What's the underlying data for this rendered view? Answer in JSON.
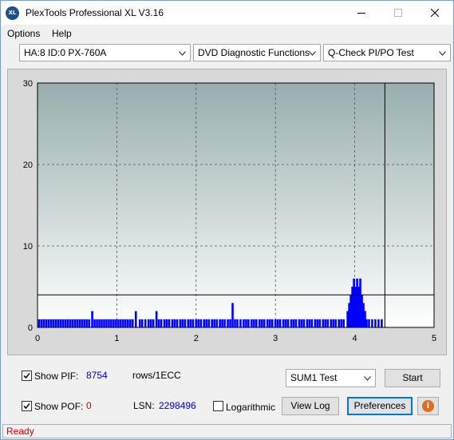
{
  "window": {
    "title": "PlexTools Professional XL V3.16",
    "icon_text": "XL"
  },
  "menu": {
    "options": "Options",
    "help": "Help"
  },
  "toolbar": {
    "drive": "HA:8 ID:0  PX-760A",
    "function": "DVD Diagnostic Functions",
    "test": "Q-Check PI/PO Test"
  },
  "chart_data": {
    "type": "bar",
    "title": "",
    "xlabel": "",
    "ylabel": "",
    "xlim": [
      0,
      5
    ],
    "ylim": [
      0,
      30
    ],
    "x_ticks": [
      "0",
      "1",
      "2",
      "3",
      "4",
      "5"
    ],
    "y_ticks": [
      "0",
      "10",
      "20",
      "30"
    ],
    "grid": true,
    "threshold_y": 4,
    "end_marker_x": 4.38,
    "colors": {
      "bars": "#0000ff",
      "cursor": "#000000"
    },
    "series": [
      {
        "values": [
          [
            0.02,
            1
          ],
          [
            0.05,
            1
          ],
          [
            0.08,
            1
          ],
          [
            0.11,
            1
          ],
          [
            0.14,
            1
          ],
          [
            0.17,
            1
          ],
          [
            0.2,
            1
          ],
          [
            0.23,
            1
          ],
          [
            0.26,
            1
          ],
          [
            0.29,
            1
          ],
          [
            0.32,
            1
          ],
          [
            0.35,
            1
          ],
          [
            0.38,
            1
          ],
          [
            0.41,
            1
          ],
          [
            0.44,
            1
          ],
          [
            0.47,
            1
          ],
          [
            0.5,
            1
          ],
          [
            0.53,
            1
          ],
          [
            0.56,
            1
          ],
          [
            0.59,
            1
          ],
          [
            0.62,
            1
          ],
          [
            0.65,
            1
          ],
          [
            0.69,
            2
          ],
          [
            0.72,
            1
          ],
          [
            0.75,
            1
          ],
          [
            0.78,
            1
          ],
          [
            0.81,
            1
          ],
          [
            0.84,
            1
          ],
          [
            0.87,
            1
          ],
          [
            0.9,
            1
          ],
          [
            0.93,
            1
          ],
          [
            0.96,
            1
          ],
          [
            0.99,
            1
          ],
          [
            1.02,
            1
          ],
          [
            1.05,
            1
          ],
          [
            1.08,
            1
          ],
          [
            1.11,
            1
          ],
          [
            1.14,
            1
          ],
          [
            1.17,
            1
          ],
          [
            1.2,
            1
          ],
          [
            1.24,
            2
          ],
          [
            1.29,
            1
          ],
          [
            1.32,
            1
          ],
          [
            1.36,
            1
          ],
          [
            1.4,
            1
          ],
          [
            1.43,
            1
          ],
          [
            1.46,
            1
          ],
          [
            1.5,
            2
          ],
          [
            1.53,
            1
          ],
          [
            1.56,
            1
          ],
          [
            1.6,
            1
          ],
          [
            1.63,
            1
          ],
          [
            1.66,
            1
          ],
          [
            1.7,
            1
          ],
          [
            1.73,
            1
          ],
          [
            1.76,
            1
          ],
          [
            1.8,
            1
          ],
          [
            1.83,
            1
          ],
          [
            1.86,
            1
          ],
          [
            1.9,
            1
          ],
          [
            1.93,
            1
          ],
          [
            1.96,
            1
          ],
          [
            2.0,
            1
          ],
          [
            2.03,
            1
          ],
          [
            2.06,
            1
          ],
          [
            2.1,
            1
          ],
          [
            2.13,
            1
          ],
          [
            2.16,
            1
          ],
          [
            2.2,
            1
          ],
          [
            2.23,
            1
          ],
          [
            2.26,
            1
          ],
          [
            2.3,
            1
          ],
          [
            2.33,
            1
          ],
          [
            2.36,
            1
          ],
          [
            2.4,
            1
          ],
          [
            2.43,
            1
          ],
          [
            2.46,
            3
          ],
          [
            2.49,
            1
          ],
          [
            2.52,
            1
          ],
          [
            2.56,
            1
          ],
          [
            2.6,
            1
          ],
          [
            2.63,
            1
          ],
          [
            2.66,
            1
          ],
          [
            2.7,
            1
          ],
          [
            2.73,
            1
          ],
          [
            2.76,
            1
          ],
          [
            2.8,
            1
          ],
          [
            2.83,
            1
          ],
          [
            2.86,
            1
          ],
          [
            2.9,
            1
          ],
          [
            2.93,
            1
          ],
          [
            2.96,
            1
          ],
          [
            3.0,
            1
          ],
          [
            3.03,
            1
          ],
          [
            3.06,
            1
          ],
          [
            3.1,
            1
          ],
          [
            3.13,
            1
          ],
          [
            3.16,
            1
          ],
          [
            3.2,
            1
          ],
          [
            3.23,
            1
          ],
          [
            3.26,
            1
          ],
          [
            3.3,
            1
          ],
          [
            3.33,
            1
          ],
          [
            3.36,
            1
          ],
          [
            3.4,
            1
          ],
          [
            3.43,
            1
          ],
          [
            3.46,
            1
          ],
          [
            3.5,
            1
          ],
          [
            3.53,
            1
          ],
          [
            3.56,
            1
          ],
          [
            3.6,
            1
          ],
          [
            3.63,
            1
          ],
          [
            3.66,
            1
          ],
          [
            3.7,
            1
          ],
          [
            3.73,
            1
          ],
          [
            3.76,
            1
          ],
          [
            3.8,
            1
          ],
          [
            3.83,
            1
          ],
          [
            3.86,
            1
          ],
          [
            3.91,
            2
          ],
          [
            3.93,
            3
          ],
          [
            3.95,
            4
          ],
          [
            3.97,
            5
          ],
          [
            3.99,
            6
          ],
          [
            4.01,
            5
          ],
          [
            4.03,
            6
          ],
          [
            4.05,
            5
          ],
          [
            4.07,
            6
          ],
          [
            4.09,
            4
          ],
          [
            4.11,
            3
          ],
          [
            4.13,
            2
          ],
          [
            4.15,
            1
          ],
          [
            4.18,
            1
          ],
          [
            4.22,
            1
          ],
          [
            4.26,
            1
          ],
          [
            4.3,
            1
          ],
          [
            4.34,
            1
          ]
        ]
      }
    ]
  },
  "panel": {
    "show_pif_label": "Show PIF:",
    "pif_value": "8754",
    "pif_unit": "rows/1ECC",
    "show_pof_label": "Show POF:",
    "pof_value": "0",
    "lsn_label": "LSN:",
    "lsn_value": "2298496",
    "logarithmic_label": "Logarithmic",
    "sum_test": "SUM1 Test",
    "start_button": "Start",
    "view_log_button": "View Log",
    "preferences_button": "Preferences",
    "show_pif_checked": true,
    "show_pof_checked": true,
    "logarithmic_checked": false
  },
  "status": {
    "text": "Ready"
  }
}
